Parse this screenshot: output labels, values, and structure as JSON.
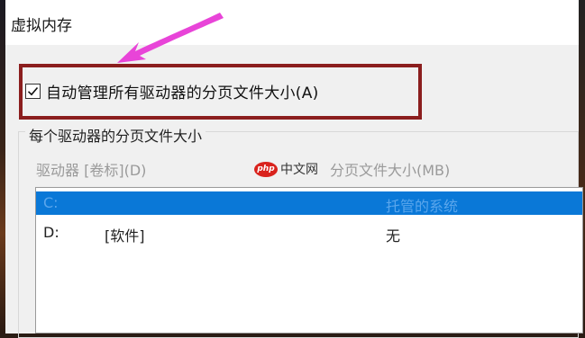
{
  "window": {
    "title": "虚拟内存"
  },
  "auto_manage": {
    "label": "自动管理所有驱动器的分页文件大小(A)",
    "checked": true
  },
  "group": {
    "title": "每个驱动器的分页文件大小",
    "col_drive": "驱动器 [卷标](D)",
    "col_size": "分页文件大小(MB)"
  },
  "watermark": {
    "logo": "php",
    "text": "中文网"
  },
  "drives": [
    {
      "drive": "C:",
      "label": "",
      "size": "托管的系统",
      "selected": true
    },
    {
      "drive": "D:",
      "label": "[软件]",
      "size": "无",
      "selected": false
    }
  ],
  "colors": {
    "highlight_box": "#8b1e1e",
    "arrow": "#e844d8",
    "selection": "#0a78d7"
  }
}
